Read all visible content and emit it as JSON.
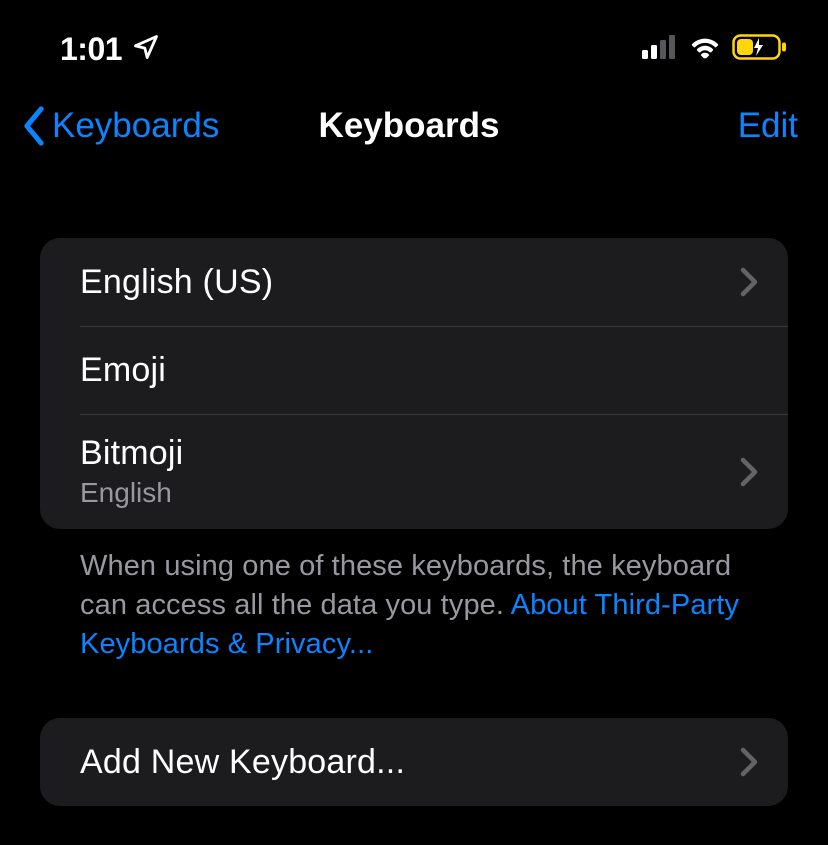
{
  "status": {
    "time": "1:01"
  },
  "nav": {
    "back_label": "Keyboards",
    "title": "Keyboards",
    "edit_label": "Edit"
  },
  "keyboards": [
    {
      "label": "English (US)",
      "sublabel": null,
      "chevron": true
    },
    {
      "label": "Emoji",
      "sublabel": null,
      "chevron": false
    },
    {
      "label": "Bitmoji",
      "sublabel": "English",
      "chevron": true
    }
  ],
  "footer": {
    "text": "When using one of these keyboards, the keyboard can access all the data you type. ",
    "link": "About Third-Party Keyboards & Privacy..."
  },
  "add": {
    "label": "Add New Keyboard..."
  }
}
